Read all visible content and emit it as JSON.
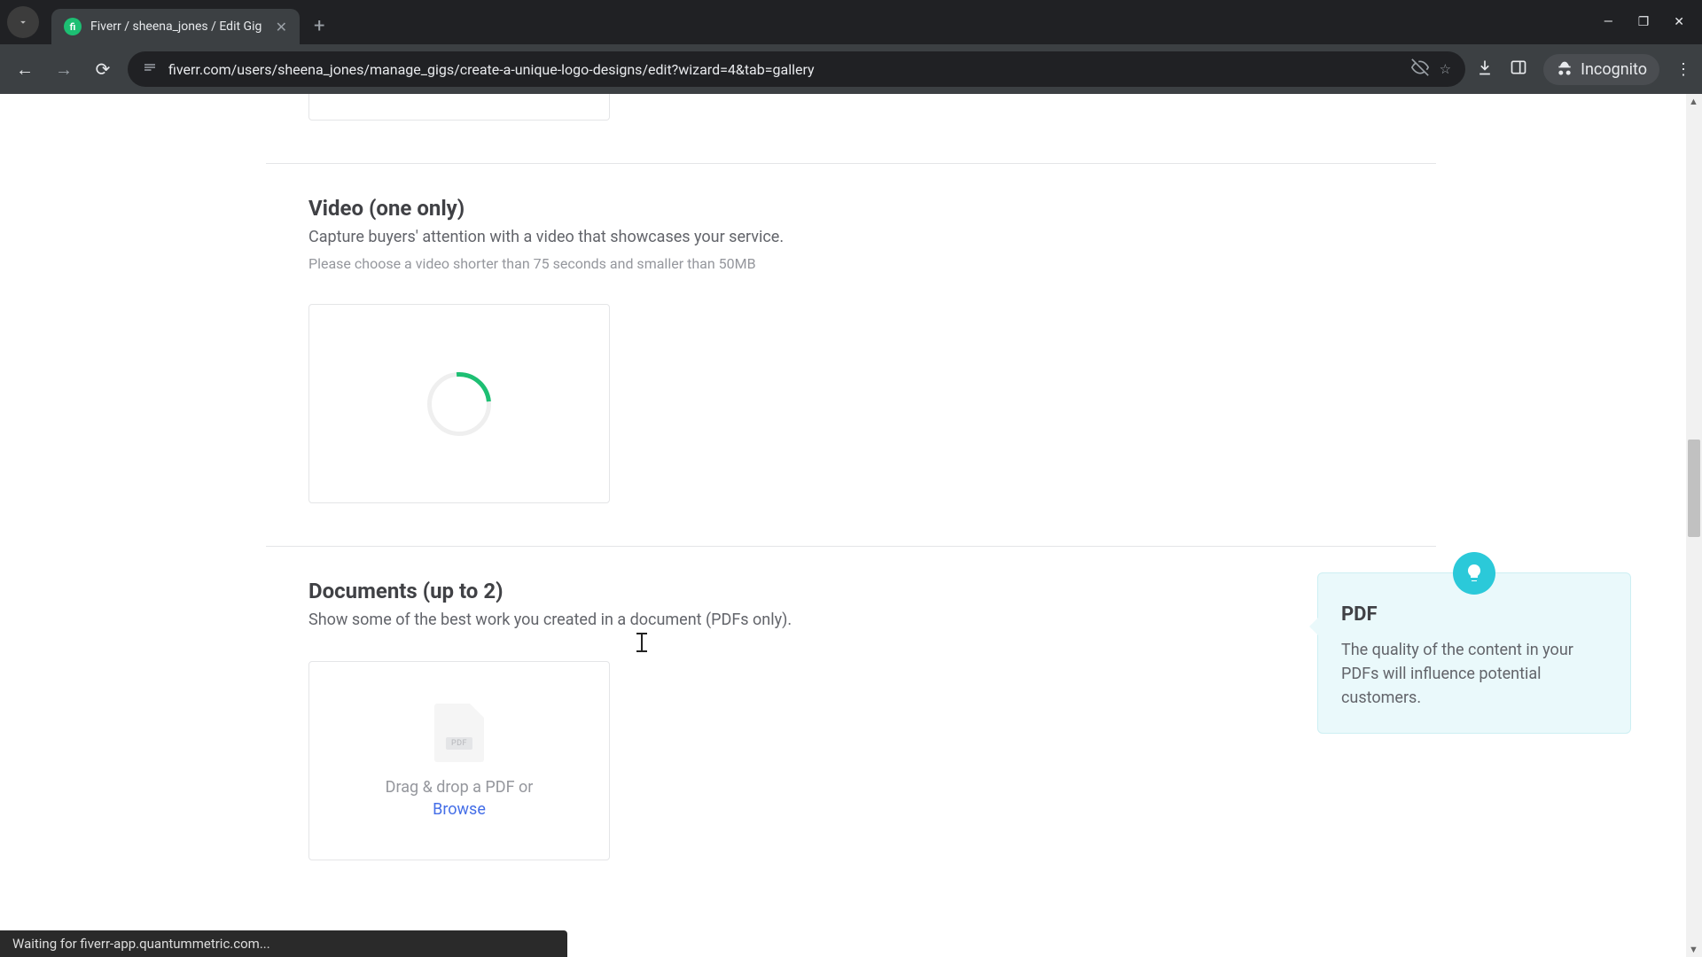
{
  "browser": {
    "tab_title": "Fiverr / sheena_jones / Edit Gig",
    "url": "fiverr.com/users/sheena_jones/manage_gigs/create-a-unique-logo-designs/edit?wizard=4&tab=gallery",
    "incognito_label": "Incognito",
    "status_text": "Waiting for fiverr-app.quantummetric.com..."
  },
  "sections": {
    "video": {
      "title": "Video (one only)",
      "subtitle": "Capture buyers' attention with a video that showcases your service.",
      "note": "Please choose a video shorter than 75 seconds and smaller than 50MB"
    },
    "documents": {
      "title": "Documents (up to 2)",
      "subtitle": "Show some of the best work you created in a document (PDFs only).",
      "drop_text": "Drag & drop a PDF or",
      "browse": "Browse",
      "pdf_badge": "PDF"
    }
  },
  "tooltip": {
    "title": "PDF",
    "text": "The quality of the content in your PDFs will influence potential customers."
  }
}
